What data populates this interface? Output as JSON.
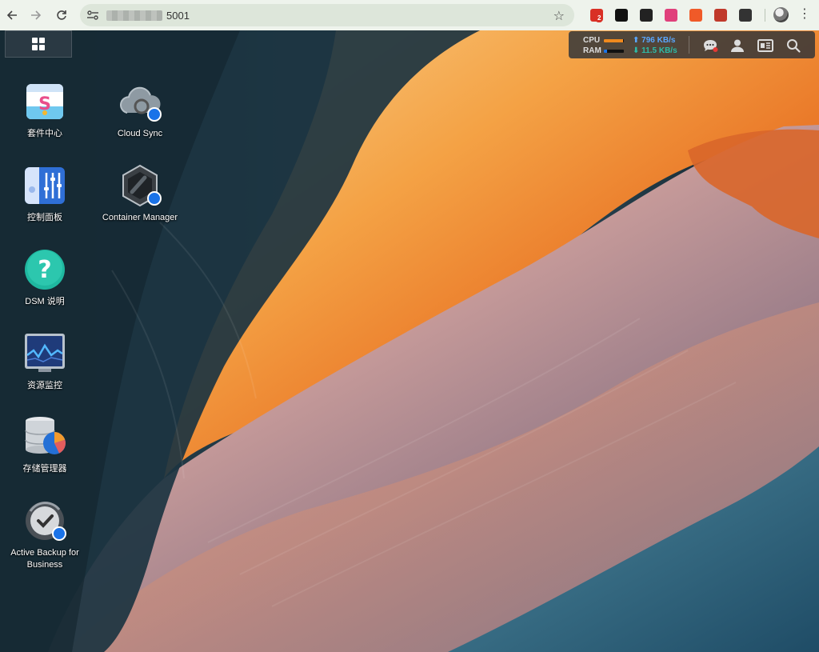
{
  "browser": {
    "url_text": "5001",
    "extensions": [
      {
        "name": "mail-extension-icon",
        "color": "#d93025",
        "badge": "2"
      },
      {
        "name": "circle-extension-icon",
        "color": "#111111",
        "badge": ""
      },
      {
        "name": "shield-extension-icon",
        "color": "#222222",
        "badge": ""
      },
      {
        "name": "translate-extension-icon",
        "color": "#e0407b",
        "badge": ""
      },
      {
        "name": "orange-extension-icon",
        "color": "#f05a28",
        "badge": ""
      },
      {
        "name": "rocket-extension-icon",
        "color": "#c0392b",
        "badge": ""
      },
      {
        "name": "puzzle-extension-icon",
        "color": "#333333",
        "badge": ""
      }
    ]
  },
  "tray": {
    "cpu_label": "CPU",
    "ram_label": "RAM",
    "cpu_level": 0.95,
    "ram_level": 0.15,
    "upload": "796 KB/s",
    "download": "11.5 KB/s",
    "accent": "#f0891e",
    "net_color": "#5aa7ff"
  },
  "shortcuts": [
    {
      "label": "套件中心",
      "icon": "package-center-icon"
    },
    {
      "label": "Cloud Sync",
      "icon": "cloud-sync-icon"
    },
    {
      "label": "控制面板",
      "icon": "control-panel-icon"
    },
    {
      "label": "Container Manager",
      "icon": "container-manager-icon"
    },
    {
      "label": "DSM 说明",
      "icon": "dsm-help-icon"
    },
    {
      "label": "资源监控",
      "icon": "resource-monitor-icon"
    },
    {
      "label": "存储管理器",
      "icon": "storage-manager-icon"
    },
    {
      "label": "Active Backup for\nBusiness",
      "icon": "active-backup-icon"
    }
  ]
}
